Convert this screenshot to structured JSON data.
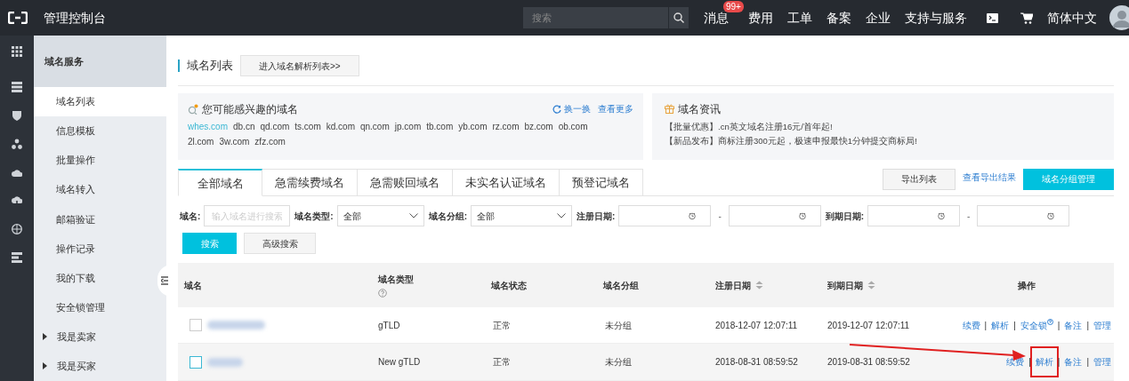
{
  "top_bar": {
    "title": "管理控制台",
    "search": {
      "placeholder": "搜索"
    },
    "nav": [
      {
        "label": "消息",
        "badge": "99+"
      },
      {
        "label": "费用"
      },
      {
        "label": "工单"
      },
      {
        "label": "备案"
      },
      {
        "label": "企业"
      },
      {
        "label": "支持与服务"
      }
    ],
    "language": "简体中文"
  },
  "sidebar": {
    "header": "域名服务",
    "items": [
      {
        "label": "域名列表",
        "kind": "link",
        "selected": true
      },
      {
        "label": "信息模板",
        "kind": "link",
        "selected": false
      },
      {
        "label": "批量操作",
        "kind": "link",
        "selected": false
      },
      {
        "label": "域名转入",
        "kind": "link",
        "selected": false
      },
      {
        "label": "邮箱验证",
        "kind": "link",
        "selected": false
      },
      {
        "label": "操作记录",
        "kind": "link",
        "selected": false
      },
      {
        "label": "我的下载",
        "kind": "link",
        "selected": false
      },
      {
        "label": "安全锁管理",
        "kind": "link",
        "selected": false
      },
      {
        "label": "我是卖家",
        "kind": "group",
        "selected": false
      },
      {
        "label": "我是买家",
        "kind": "group",
        "selected": false
      }
    ]
  },
  "page": {
    "title": "域名列表",
    "button": "进入域名解析列表>>"
  },
  "suggest_card": {
    "title": "您可能感兴趣的域名",
    "actions": [
      "换一换",
      "查看更多"
    ],
    "domains": [
      {
        "text": "whes.com",
        "highlighted": true
      },
      {
        "text": "db.cn",
        "highlighted": false
      },
      {
        "text": "qd.com",
        "highlighted": false
      },
      {
        "text": "ts.com",
        "highlighted": false
      },
      {
        "text": "kd.com",
        "highlighted": false
      },
      {
        "text": "qn.com",
        "highlighted": false
      },
      {
        "text": "jp.com",
        "highlighted": false
      },
      {
        "text": "tb.com",
        "highlighted": false
      },
      {
        "text": "yb.com",
        "highlighted": false
      },
      {
        "text": "rz.com",
        "highlighted": false
      },
      {
        "text": "bz.com",
        "highlighted": false
      },
      {
        "text": "ob.com",
        "highlighted": false
      },
      {
        "text": "2l.com",
        "highlighted": false
      },
      {
        "text": "3w.com",
        "highlighted": false
      },
      {
        "text": "zfz.com",
        "highlighted": false
      }
    ]
  },
  "news_card": {
    "title": "域名资讯",
    "lines": [
      "【批量优惠】.cn英文域名注册16元/首年起!",
      "【新品发布】商标注册300元起，极速申报最快1分钟提交商标局!"
    ]
  },
  "tabs": [
    {
      "label": "全部域名",
      "selected": true
    },
    {
      "label": "急需续费域名",
      "selected": false
    },
    {
      "label": "急需赎回域名",
      "selected": false
    },
    {
      "label": "未实名认证域名",
      "selected": false
    },
    {
      "label": "预登记域名",
      "selected": false
    }
  ],
  "toolbar": {
    "export": "导出列表",
    "view_results": "查看导出结果",
    "group_manage": "域名分组管理"
  },
  "filters": [
    {
      "kind": "text",
      "label": "域名:",
      "placeholder": "输入域名进行搜索"
    },
    {
      "kind": "select",
      "label": "域名类型:",
      "value": "全部"
    },
    {
      "kind": "select",
      "label": "域名分组:",
      "value": "全部"
    },
    {
      "kind": "daterange",
      "label": "注册日期:",
      "separator": "-"
    },
    {
      "kind": "daterange",
      "label": "到期日期:",
      "separator": "-"
    }
  ],
  "search_buttons": [
    "搜索",
    "高级搜索"
  ],
  "table": {
    "columns": [
      {
        "label": "域名",
        "kind": "plain"
      },
      {
        "label": "域名类型",
        "kind": "help"
      },
      {
        "label": "域名状态",
        "kind": "plain"
      },
      {
        "label": "域名分组",
        "kind": "plain"
      },
      {
        "label": "注册日期",
        "kind": "sortable"
      },
      {
        "label": "到期日期",
        "kind": "sortable"
      },
      {
        "label": "操作",
        "kind": "plain"
      }
    ],
    "rows": [
      {
        "checked": false,
        "hovered": false,
        "type": "gTLD",
        "status": "正常",
        "group": "未分组",
        "registered": "2018-12-07 12:07:11",
        "expires": "2019-12-07 12:07:11",
        "actions": [
          {
            "label": "续费",
            "help": false,
            "boxed": false
          },
          {
            "separator": "|",
            "label": "解析",
            "help": false,
            "boxed": false
          },
          {
            "separator": "|",
            "label": "安全锁",
            "help": true,
            "boxed": false
          },
          {
            "separator": "|",
            "label": "备注",
            "help": false,
            "boxed": false
          },
          {
            "separator": "|",
            "label": "管理",
            "help": false,
            "boxed": false
          }
        ]
      },
      {
        "checked": false,
        "hovered": true,
        "type": "New gTLD",
        "status": "正常",
        "group": "未分组",
        "registered": "2018-08-31 08:59:52",
        "expires": "2019-08-31 08:59:52",
        "actions": [
          {
            "label": "续费",
            "help": false,
            "boxed": false
          },
          {
            "separator": "|",
            "label": "解析",
            "help": false,
            "boxed": true
          },
          {
            "separator": "|",
            "label": "备注",
            "help": false,
            "boxed": false
          },
          {
            "separator": "|",
            "label": "管理",
            "help": false,
            "boxed": false
          }
        ]
      }
    ]
  }
}
